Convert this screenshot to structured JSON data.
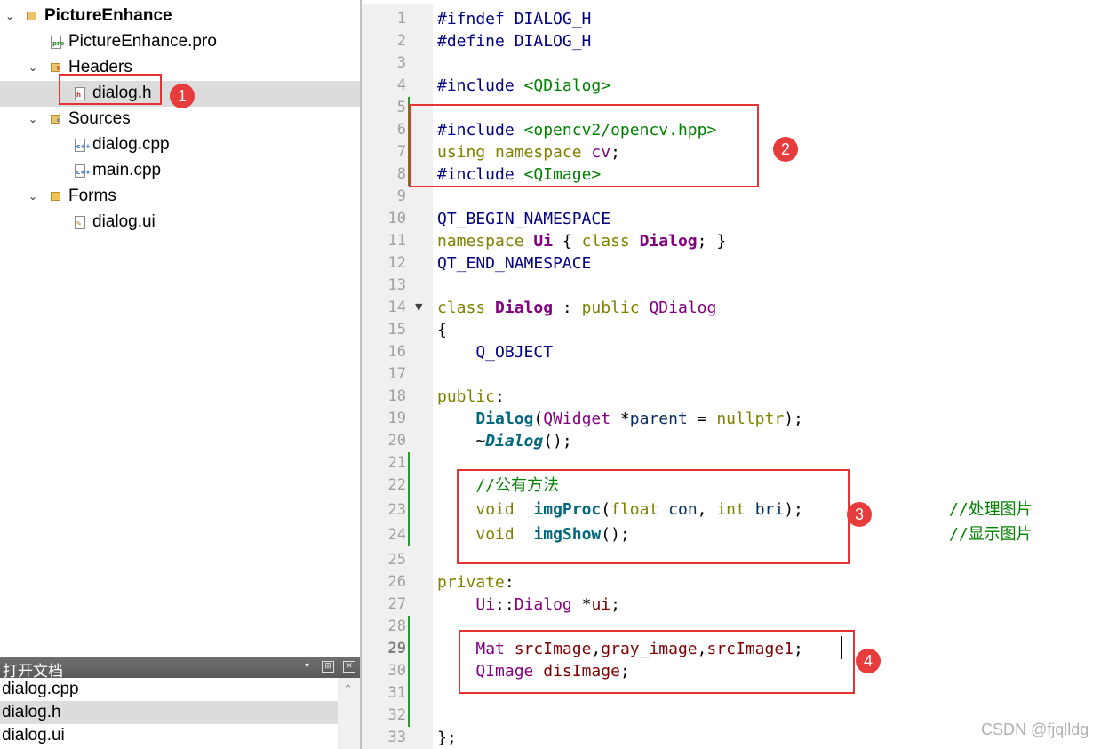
{
  "project_tree": {
    "project": "PictureEnhance",
    "pro_file": "PictureEnhance.pro",
    "headers_label": "Headers",
    "headers_file": "dialog.h",
    "sources_label": "Sources",
    "sources_files": [
      "dialog.cpp",
      "main.cpp"
    ],
    "forms_label": "Forms",
    "forms_file": "dialog.ui"
  },
  "open_documents": {
    "title": "打开文档",
    "items": [
      "dialog.cpp",
      "dialog.h",
      "dialog.ui"
    ],
    "selected": "dialog.h"
  },
  "editor": {
    "current_line": "29",
    "line_numbers": [
      "1",
      "2",
      "3",
      "4",
      "5",
      "6",
      "7",
      "8",
      "9",
      "10",
      "11",
      "12",
      "13",
      "14",
      "15",
      "16",
      "17",
      "18",
      "19",
      "20",
      "21",
      "22",
      "23",
      "24",
      "25",
      "26",
      "27",
      "28",
      "29",
      "30",
      "31",
      "32",
      "33"
    ],
    "code": {
      "l1": "#ifndef DIALOG_H",
      "l2": "#define DIALOG_H",
      "l4a": "#include ",
      "l4b": "<QDialog>",
      "l6a": "#include ",
      "l6b": "<opencv2/opencv.hpp>",
      "l7a": "using namespace ",
      "l7b": "cv",
      "l7c": ";",
      "l8a": "#include ",
      "l8b": "<QImage>",
      "l10": "QT_BEGIN_NAMESPACE",
      "l11a": "namespace ",
      "l11b": "Ui",
      "l11c": " { ",
      "l11d": "class ",
      "l11e": "Dialog",
      "l11f": "; }",
      "l12": "QT_END_NAMESPACE",
      "l14a": "class ",
      "l14b": "Dialog",
      "l14c": " : ",
      "l14d": "public ",
      "l14e": "QDialog",
      "l15": "{",
      "l16": "    Q_OBJECT",
      "l18a": "public",
      "l18b": ":",
      "l19a": "    ",
      "l19b": "Dialog",
      "l19c": "(",
      "l19d": "QWidget",
      "l19e": " *",
      "l19f": "parent",
      "l19g": " = ",
      "l19h": "nullptr",
      "l19i": ");",
      "l20a": "    ~",
      "l20b": "Dialog",
      "l20c": "();",
      "l22": "    //公有方法",
      "l23a": "    ",
      "l23b": "void",
      "l23c": "  ",
      "l23d": "imgProc",
      "l23e": "(",
      "l23f": "float",
      "l23g": " ",
      "l23h": "con",
      "l23i": ", ",
      "l23j": "int",
      "l23k": " ",
      "l23l": "bri",
      "l23m": ");",
      "l23cm": "//处理图片",
      "l24a": "    ",
      "l24b": "void",
      "l24c": "  ",
      "l24d": "imgShow",
      "l24e": "();",
      "l24cm": "//显示图片",
      "l26a": "private",
      "l26b": ":",
      "l27a": "    ",
      "l27b": "Ui",
      "l27c": "::",
      "l27d": "Dialog",
      "l27e": " *",
      "l27f": "ui",
      "l27g": ";",
      "l29a": "    ",
      "l29b": "Mat",
      "l29c": " ",
      "l29d": "srcImage",
      "l29e": ",",
      "l29f": "gray_image",
      "l29g": ",",
      "l29h": "srcImage1",
      "l29i": ";",
      "l30a": "    ",
      "l30b": "QImage",
      "l30c": " ",
      "l30d": "disImage",
      "l30e": ";",
      "l33": "};"
    }
  },
  "annotations": [
    "1",
    "2",
    "3",
    "4"
  ],
  "watermark": "CSDN @fjqlldg",
  "colors": {
    "annotation_red": "#e53333",
    "change_bar_green": "#2b9a2b",
    "selection_gray": "#dcdcdc"
  }
}
